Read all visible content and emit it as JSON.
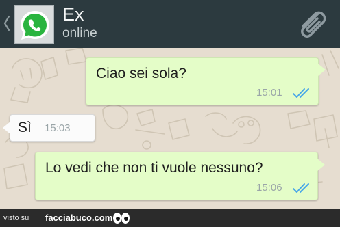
{
  "header": {
    "back_icon": "chevron-left-icon",
    "avatar_icon": "whatsapp-logo-icon",
    "contact_name": "Ex",
    "status": "online",
    "attach_icon": "paperclip-icon"
  },
  "messages": [
    {
      "direction": "outgoing",
      "text": "Ciao sei sola?",
      "time": "15:01",
      "status_icon": "double-check-read-icon"
    },
    {
      "direction": "incoming",
      "text": "Sì",
      "time": "15:03"
    },
    {
      "direction": "outgoing",
      "text": "Lo vedi che non ti vuole nessuno?",
      "time": "15:06",
      "status_icon": "double-check-read-icon"
    }
  ],
  "footer": {
    "prefix": "visto su",
    "site": "facciabuco.com",
    "logo_icon": "eyes-icon"
  },
  "colors": {
    "header_bg": "#2c3a3f",
    "outgoing_bubble": "#e4fdc8",
    "incoming_bubble": "#fbfbfb",
    "read_ticks": "#4aa8e8",
    "whatsapp_green": "#29b43f"
  }
}
